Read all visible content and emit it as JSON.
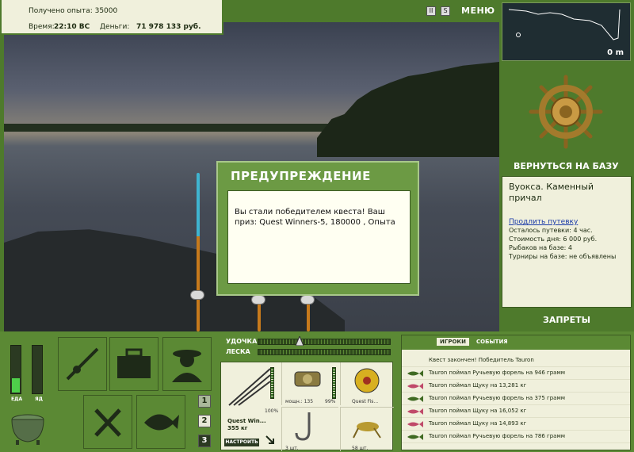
{
  "info": {
    "exp_label": "Получено опыта: 35000",
    "time_label": "Время:",
    "time_value": "22:10 ВС",
    "money_label": "Деньги:",
    "money_value": "71 978 133 руб."
  },
  "top_icons": {
    "pause": "II",
    "sound": "S",
    "menu": "МЕНЮ"
  },
  "minimap": {
    "distance": "0 m"
  },
  "right": {
    "return_label": "ВЕРНУТЬСЯ НА БАЗУ",
    "location": "Вуокса. Каменный причал",
    "extend_link": "Продлить путевку",
    "lines": [
      "Осталось путевки: 4 час.",
      "Стоимость дня: 6 000 руб.",
      "Рыбаков на базе: 4",
      "Турниры на базе: не объявлены"
    ],
    "bans_label": "ЗАПРЕТЫ"
  },
  "dialog": {
    "title": "ПРЕДУПРЕЖДЕНИЕ",
    "message": "Вы стали победителем квеста! Ваш приз: Quest Winners-5, 180000 , Опыта"
  },
  "needs": {
    "food_label": "ЕДА",
    "poison_label": "ЯД",
    "food_level": 0.3,
    "poison_level": 0
  },
  "pages": [
    "1",
    "2",
    "3"
  ],
  "tackle": {
    "rod_label": "УДОЧКА",
    "line_label": "ЛЕСКА",
    "rod_name_1": "Quest Win...",
    "rod_name_2": "355 кг",
    "rod_percent": "100%",
    "reel_power": "мощн.: 135",
    "reel_percent": "99%",
    "line_name": "Quest Fis...",
    "hooks_count": "3 шт.",
    "bait_count": "58 шт.",
    "config_label": "НАСТРОИТЬ"
  },
  "events": {
    "tabs": [
      "ИГРОКИ",
      "СОБЫТИЯ"
    ],
    "items": [
      "Квест закончен! Победитель Tauron",
      "Tauron поймал Ручьевую форель на 946 грамм",
      "Tauron поймал Щуку на 13,281 кг",
      "Tauron поймал Ручьевую форель на 375 грамм",
      "Tauron поймал Щуку на 16,052 кг",
      "Tauron поймал Щуку на 14,893 кг",
      "Tauron поймал Ручьевую форель на 786 грамм"
    ],
    "icons": [
      "none",
      "trout-icon",
      "pike-icon",
      "trout-icon",
      "pike-icon",
      "pike-icon",
      "trout-icon"
    ]
  }
}
